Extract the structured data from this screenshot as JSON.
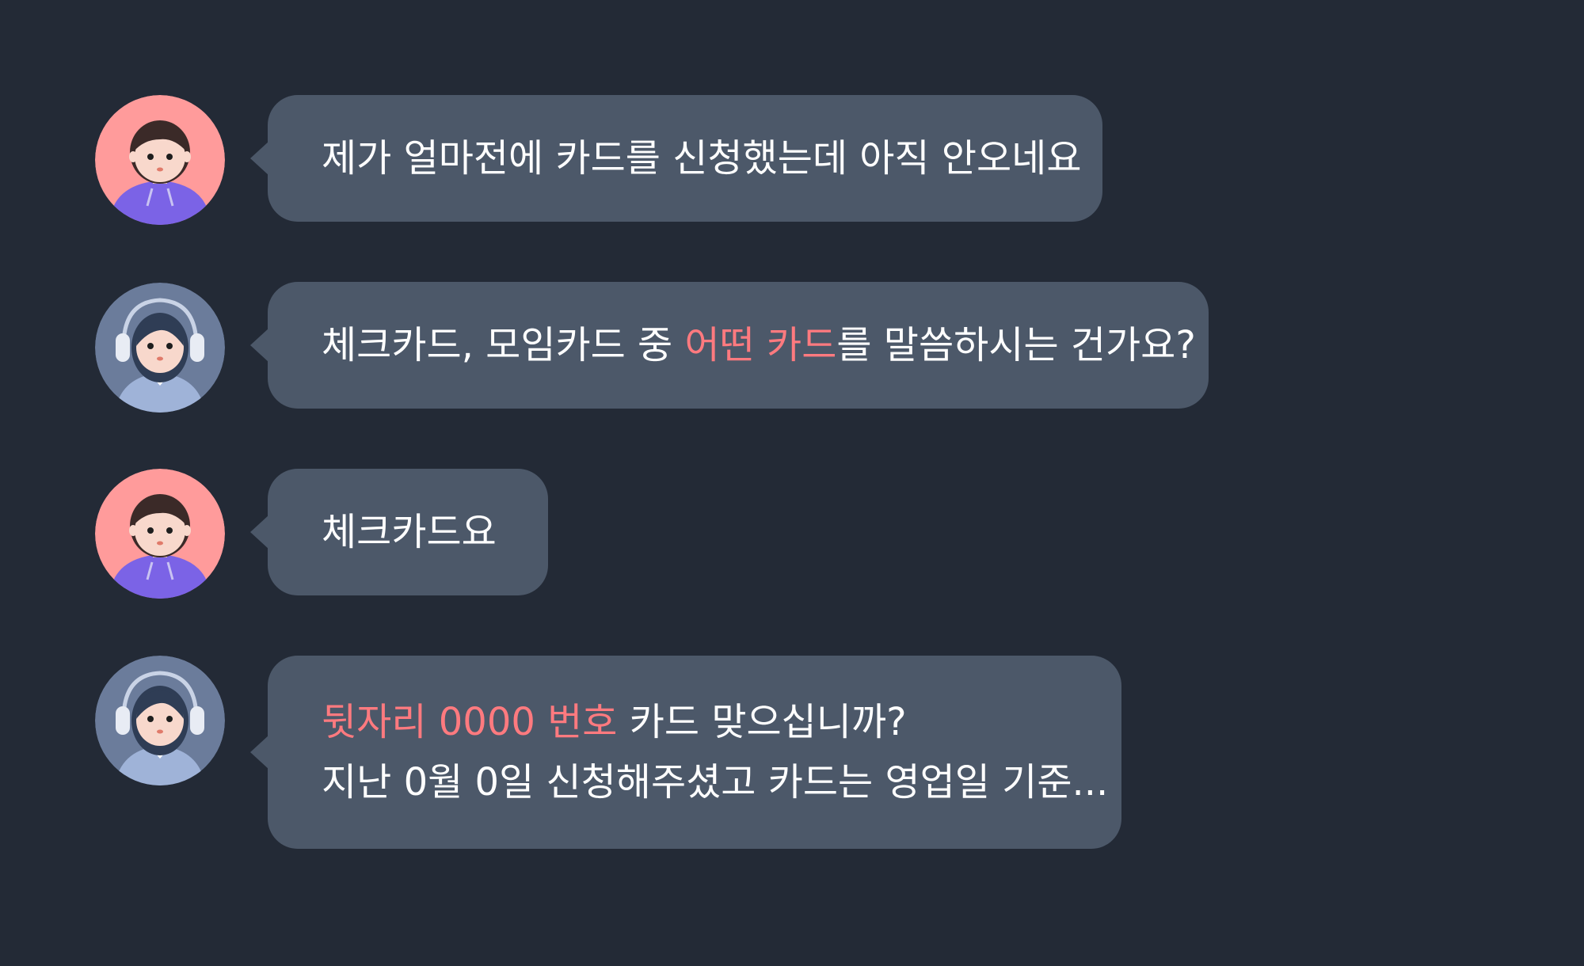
{
  "colors": {
    "background": "#232a36",
    "bubble": "#4c5869",
    "highlight": "#ff7a7f",
    "customer_avatar_bg": "#ff9b9b",
    "agent_avatar_bg": "#6b7c9b"
  },
  "messages": [
    {
      "sender": "customer",
      "avatar_icon": "customer-avatar-icon",
      "lines": [
        [
          {
            "text": "제가 얼마전에 카드를 신청했는데 아직 안오네요",
            "highlight": false
          }
        ]
      ]
    },
    {
      "sender": "agent",
      "avatar_icon": "agent-headset-avatar-icon",
      "lines": [
        [
          {
            "text": "체크카드, 모임카드 중 ",
            "highlight": false
          },
          {
            "text": "어떤 카드",
            "highlight": true
          },
          {
            "text": "를 말씀하시는 건가요?",
            "highlight": false
          }
        ]
      ]
    },
    {
      "sender": "customer",
      "avatar_icon": "customer-avatar-icon",
      "lines": [
        [
          {
            "text": "체크카드요",
            "highlight": false
          }
        ]
      ]
    },
    {
      "sender": "agent",
      "avatar_icon": "agent-headset-avatar-icon",
      "lines": [
        [
          {
            "text": "뒷자리 0000 번호",
            "highlight": true
          },
          {
            "text": " 카드 맞으십니까?",
            "highlight": false
          }
        ],
        [
          {
            "text": "지난 0월 0일 신청해주셨고 카드는 영업일 기준...",
            "highlight": false
          }
        ]
      ]
    }
  ]
}
